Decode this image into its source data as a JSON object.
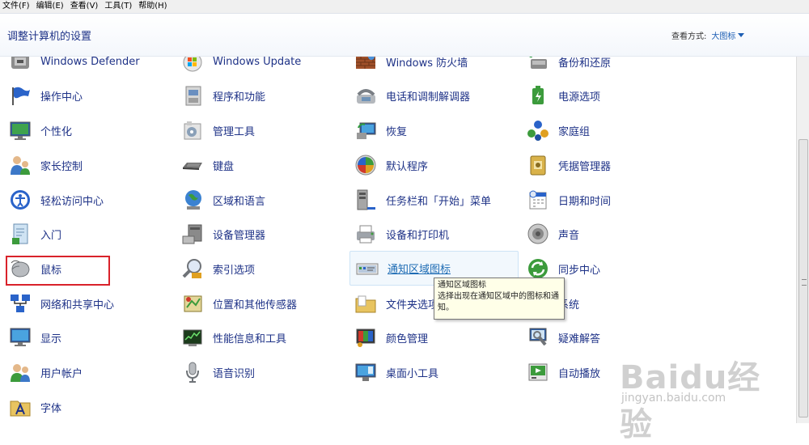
{
  "menubar": [
    "文件(F)",
    "编辑(E)",
    "查看(V)",
    "工具(T)",
    "帮助(H)"
  ],
  "header": {
    "title": "调整计算机的设置",
    "view_label": "查看方式:",
    "view_value": "大图标"
  },
  "items": [
    {
      "label": "Windows Defender",
      "icon": "windows-defender-icon"
    },
    {
      "label": "Windows Update",
      "icon": "windows-update-icon"
    },
    {
      "label": "Windows 防火墙",
      "icon": "firewall-icon"
    },
    {
      "label": "备份和还原",
      "icon": "backup-restore-icon"
    },
    {
      "label": "操作中心",
      "icon": "action-center-flag-icon"
    },
    {
      "label": "程序和功能",
      "icon": "programs-features-icon"
    },
    {
      "label": "电话和调制解调器",
      "icon": "phone-modem-icon"
    },
    {
      "label": "电源选项",
      "icon": "power-options-icon"
    },
    {
      "label": "个性化",
      "icon": "personalization-icon"
    },
    {
      "label": "管理工具",
      "icon": "admin-tools-icon"
    },
    {
      "label": "恢复",
      "icon": "recovery-icon"
    },
    {
      "label": "家庭组",
      "icon": "homegroup-icon"
    },
    {
      "label": "家长控制",
      "icon": "parental-controls-icon"
    },
    {
      "label": "键盘",
      "icon": "keyboard-icon"
    },
    {
      "label": "默认程序",
      "icon": "default-programs-icon"
    },
    {
      "label": "凭据管理器",
      "icon": "credential-manager-icon"
    },
    {
      "label": "轻松访问中心",
      "icon": "ease-of-access-icon"
    },
    {
      "label": "区域和语言",
      "icon": "region-language-globe-icon"
    },
    {
      "label": "任务栏和「开始」菜单",
      "icon": "taskbar-start-menu-icon"
    },
    {
      "label": "日期和时间",
      "icon": "date-time-icon"
    },
    {
      "label": "入门",
      "icon": "getting-started-icon"
    },
    {
      "label": "设备管理器",
      "icon": "device-manager-icon"
    },
    {
      "label": "设备和打印机",
      "icon": "devices-printers-icon"
    },
    {
      "label": "声音",
      "icon": "sound-speaker-icon"
    },
    {
      "label": "鼠标",
      "icon": "mouse-icon"
    },
    {
      "label": "索引选项",
      "icon": "indexing-options-icon"
    },
    {
      "label": "通知区域图标",
      "icon": "notification-area-icon"
    },
    {
      "label": "同步中心",
      "icon": "sync-center-icon"
    },
    {
      "label": "网络和共享中心",
      "icon": "network-sharing-icon"
    },
    {
      "label": "位置和其他传感器",
      "icon": "location-sensors-icon"
    },
    {
      "label": "文件夹选项",
      "icon": "folder-options-icon"
    },
    {
      "label": "系统",
      "icon": "system-icon"
    },
    {
      "label": "显示",
      "icon": "display-icon"
    },
    {
      "label": "性能信息和工具",
      "icon": "performance-icon"
    },
    {
      "label": "颜色管理",
      "icon": "color-management-icon"
    },
    {
      "label": "疑难解答",
      "icon": "troubleshooting-icon"
    },
    {
      "label": "用户帐户",
      "icon": "user-accounts-icon"
    },
    {
      "label": "语音识别",
      "icon": "speech-recognition-icon"
    },
    {
      "label": "桌面小工具",
      "icon": "desktop-gadgets-icon"
    },
    {
      "label": "自动播放",
      "icon": "autoplay-icon"
    },
    {
      "label": "字体",
      "icon": "fonts-icon"
    }
  ],
  "tooltip": {
    "title": "通知区域图标",
    "text": "选择出现在通知区域中的图标和通知。"
  },
  "watermark": {
    "logo": "Baidu经验",
    "url": "jingyan.baidu.com"
  }
}
